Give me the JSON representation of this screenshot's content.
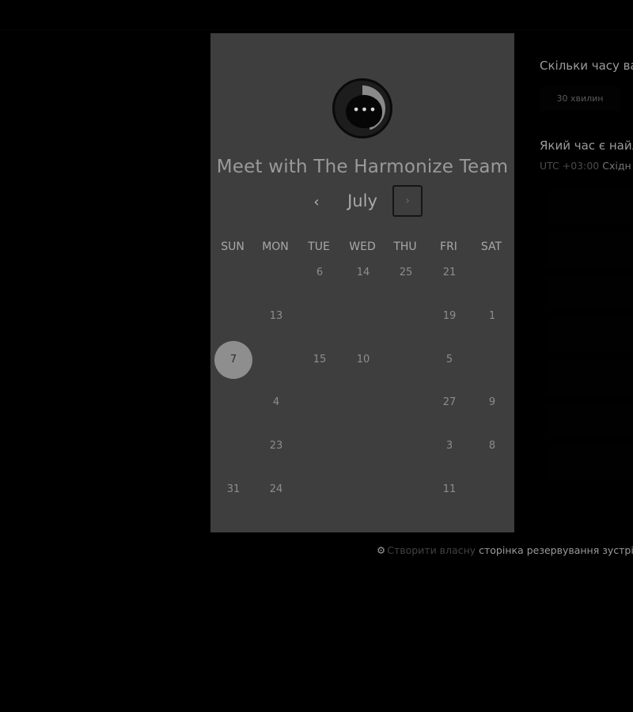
{
  "meeting": {
    "title": "Meet with The Harmonize Team",
    "logo_icon": "chat-bubble-dots-icon",
    "logo_dots": "•••"
  },
  "calendar": {
    "month": "July",
    "prev_icon": "‹",
    "next_icon": "›",
    "weekdays": [
      "SUN",
      "MON",
      "TUE",
      "WED",
      "THU",
      "FRI",
      "SAT"
    ],
    "days": [
      [
        "",
        "",
        "6",
        "14",
        "25",
        "21",
        ""
      ],
      [
        "",
        "13",
        "",
        "",
        "",
        "19",
        "1"
      ],
      [
        "7",
        "",
        "15",
        "10",
        "",
        "5",
        ""
      ],
      [
        "",
        "4",
        "",
        "",
        "",
        "27",
        "9"
      ],
      [
        "",
        "23",
        "",
        "",
        "",
        "3",
        "8"
      ],
      [
        "31",
        "24",
        "",
        "",
        "",
        "11",
        ""
      ]
    ],
    "selected": "7"
  },
  "right": {
    "duration_question": "Скільки часу ва",
    "duration_option": "30 хвилин",
    "time_question": "Який час є найл",
    "timezone_offset": "UTC +03:00",
    "timezone_name": "Східн"
  },
  "footer": {
    "icon": "hubspot-sprocket-icon",
    "icon_glyph": "⚙",
    "create_text": "Створити власну",
    "page_text": "сторінка резервування зустрі"
  },
  "colors": {
    "background": "#000000",
    "panel": "#3e3e3e",
    "selected_day": "#8e8e8e"
  }
}
